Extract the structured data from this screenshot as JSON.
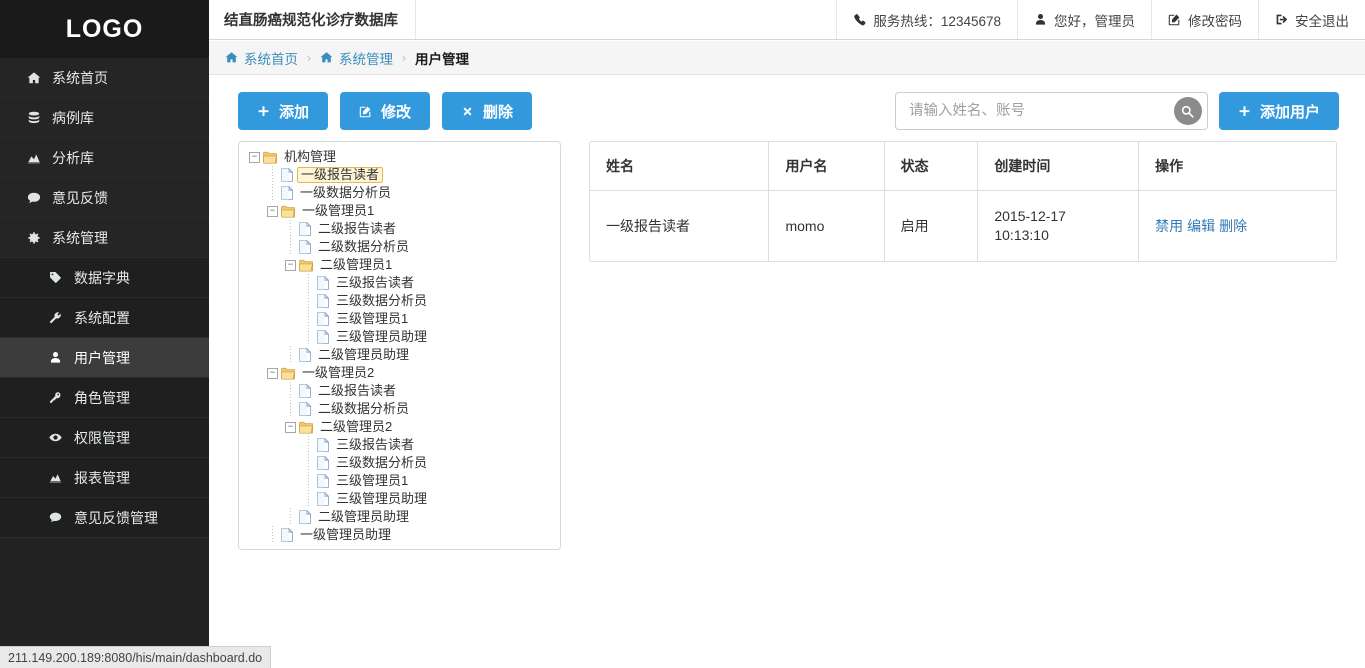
{
  "sidebar": {
    "logo": "LOGO",
    "items": [
      {
        "label": "系统首页",
        "icon": "home-icon",
        "level": 1,
        "active": false
      },
      {
        "label": "病例库",
        "icon": "database-icon",
        "level": 1,
        "active": false
      },
      {
        "label": "分析库",
        "icon": "chart-area-icon",
        "level": 1,
        "active": false
      },
      {
        "label": "意见反馈",
        "icon": "comment-icon",
        "level": 1,
        "active": false
      },
      {
        "label": "系统管理",
        "icon": "gear-icon",
        "level": 1,
        "active": false
      },
      {
        "label": "数据字典",
        "icon": "tag-icon",
        "level": 2,
        "active": false
      },
      {
        "label": "系统配置",
        "icon": "wrench-icon",
        "level": 2,
        "active": false
      },
      {
        "label": "用户管理",
        "icon": "user-icon",
        "level": 2,
        "active": true
      },
      {
        "label": "角色管理",
        "icon": "key-icon",
        "level": 2,
        "active": false
      },
      {
        "label": "权限管理",
        "icon": "eye-icon",
        "level": 2,
        "active": false
      },
      {
        "label": "报表管理",
        "icon": "chart-area-icon",
        "level": 2,
        "active": false
      },
      {
        "label": "意见反馈管理",
        "icon": "comment-icon",
        "level": 2,
        "active": false
      }
    ]
  },
  "header": {
    "app_title": "结直肠癌规范化诊疗数据库",
    "items": [
      {
        "label": "服务热线：12345678",
        "icon": "phone-icon"
      },
      {
        "label": "您好，管理员",
        "icon": "user-icon"
      },
      {
        "label": "修改密码",
        "icon": "edit-icon"
      },
      {
        "label": "安全退出",
        "icon": "sign-out-icon"
      }
    ]
  },
  "breadcrumb": {
    "separator": "›",
    "items": [
      {
        "label": "系统首页",
        "icon": "home-icon",
        "current": false
      },
      {
        "label": "系统管理",
        "icon": "home-icon",
        "current": false
      },
      {
        "label": "用户管理",
        "icon": "",
        "current": true
      }
    ]
  },
  "toolbar": {
    "buttons": [
      {
        "label": "添加",
        "icon": "plus-icon"
      },
      {
        "label": "修改",
        "icon": "edit-icon"
      },
      {
        "label": "删除",
        "icon": "times-icon"
      }
    ]
  },
  "search": {
    "placeholder": "请输入姓名、账号",
    "value": "",
    "button_icon": "search-icon",
    "add_user_label": "添加用户",
    "add_user_icon": "plus-icon"
  },
  "tree": {
    "nodes": [
      {
        "label": "机构管理",
        "depth": 0,
        "type": "folder",
        "toggle": "minus",
        "selected": false
      },
      {
        "label": "一级报告读者",
        "depth": 1,
        "type": "file",
        "toggle": "none",
        "selected": true
      },
      {
        "label": "一级数据分析员",
        "depth": 1,
        "type": "file",
        "toggle": "none",
        "selected": false
      },
      {
        "label": "一级管理员1",
        "depth": 1,
        "type": "folder",
        "toggle": "minus",
        "selected": false
      },
      {
        "label": "二级报告读者",
        "depth": 2,
        "type": "file",
        "toggle": "none",
        "selected": false
      },
      {
        "label": "二级数据分析员",
        "depth": 2,
        "type": "file",
        "toggle": "none",
        "selected": false
      },
      {
        "label": "二级管理员1",
        "depth": 2,
        "type": "folder",
        "toggle": "minus",
        "selected": false
      },
      {
        "label": "三级报告读者",
        "depth": 3,
        "type": "file",
        "toggle": "none",
        "selected": false
      },
      {
        "label": "三级数据分析员",
        "depth": 3,
        "type": "file",
        "toggle": "none",
        "selected": false
      },
      {
        "label": "三级管理员1",
        "depth": 3,
        "type": "file",
        "toggle": "none",
        "selected": false
      },
      {
        "label": "三级管理员助理",
        "depth": 3,
        "type": "file",
        "toggle": "none",
        "selected": false
      },
      {
        "label": "二级管理员助理",
        "depth": 2,
        "type": "file",
        "toggle": "none",
        "selected": false
      },
      {
        "label": "一级管理员2",
        "depth": 1,
        "type": "folder",
        "toggle": "minus",
        "selected": false
      },
      {
        "label": "二级报告读者",
        "depth": 2,
        "type": "file",
        "toggle": "none",
        "selected": false
      },
      {
        "label": "二级数据分析员",
        "depth": 2,
        "type": "file",
        "toggle": "none",
        "selected": false
      },
      {
        "label": "二级管理员2",
        "depth": 2,
        "type": "folder",
        "toggle": "minus",
        "selected": false
      },
      {
        "label": "三级报告读者",
        "depth": 3,
        "type": "file",
        "toggle": "none",
        "selected": false
      },
      {
        "label": "三级数据分析员",
        "depth": 3,
        "type": "file",
        "toggle": "none",
        "selected": false
      },
      {
        "label": "三级管理员1",
        "depth": 3,
        "type": "file",
        "toggle": "none",
        "selected": false
      },
      {
        "label": "三级管理员助理",
        "depth": 3,
        "type": "file",
        "toggle": "none",
        "selected": false
      },
      {
        "label": "二级管理员助理",
        "depth": 2,
        "type": "file",
        "toggle": "none",
        "selected": false
      },
      {
        "label": "一级管理员助理",
        "depth": 1,
        "type": "file",
        "toggle": "none",
        "selected": false
      }
    ]
  },
  "table": {
    "columns": [
      "姓名",
      "用户名",
      "状态",
      "创建时间",
      "操作"
    ],
    "rows": [
      {
        "name": "一级报告读者",
        "username": "momo",
        "status": "启用",
        "created_date": "2015-12-17",
        "created_time": "10:13:10",
        "actions": [
          "禁用",
          "编辑",
          "删除"
        ]
      }
    ]
  },
  "statusbar": {
    "url": "211.149.200.189:8080/his/main/dashboard.do"
  },
  "colors": {
    "sidebar_bg": "#222222",
    "sidebar_active": "#3c3c3c",
    "primary_blue": "#3399dd",
    "link_blue": "#337ab7",
    "breadcrumb_link": "#3c8dbc",
    "tree_selected_bg": "#fdf5d5",
    "tree_selected_border": "#e8b84f"
  }
}
